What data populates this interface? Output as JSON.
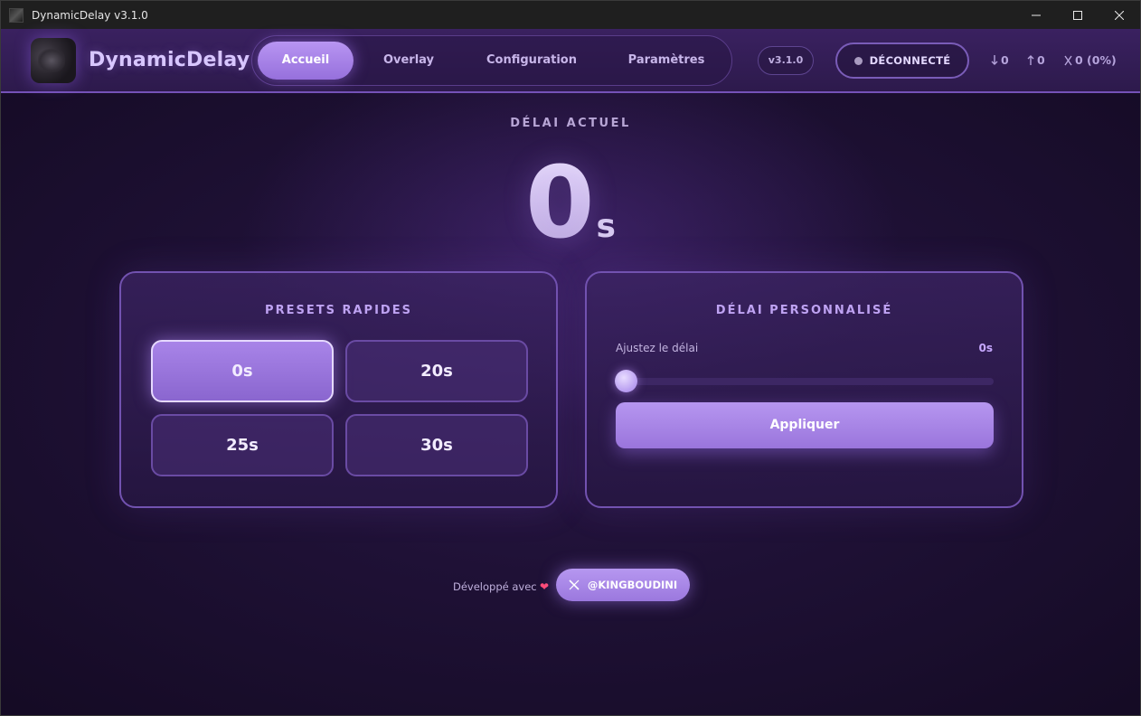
{
  "window": {
    "title": "DynamicDelay v3.1.0"
  },
  "header": {
    "brand": "DynamicDelay",
    "nav": [
      {
        "label": "Accueil",
        "active": true
      },
      {
        "label": "Overlay",
        "active": false
      },
      {
        "label": "Configuration",
        "active": false
      },
      {
        "label": "Paramètres",
        "active": false
      }
    ],
    "version": "v3.1.0",
    "status": "DÉCONNECTÉ",
    "stats": {
      "down": "0",
      "up": "0",
      "dropped": "0 (0%)"
    }
  },
  "main": {
    "current_label": "DÉLAI ACTUEL",
    "current_value": "0",
    "current_unit": "s"
  },
  "presets": {
    "title": "PRESETS RAPIDES",
    "items": [
      {
        "label": "0s",
        "active": true
      },
      {
        "label": "20s",
        "active": false
      },
      {
        "label": "25s",
        "active": false
      },
      {
        "label": "30s",
        "active": false
      }
    ]
  },
  "custom": {
    "title": "DÉLAI PERSONNALISÉ",
    "slider_label": "Ajustez le délai",
    "slider_value": "0s",
    "slider_fraction": 0,
    "apply_label": "Appliquer"
  },
  "footer": {
    "text": "Développé avec",
    "handle": "@KINGBOUDINI"
  },
  "colors": {
    "accent": "#a884e8",
    "background": "#1f1136",
    "status_dot": "#a99bc0",
    "heart": "#ff4b77"
  }
}
